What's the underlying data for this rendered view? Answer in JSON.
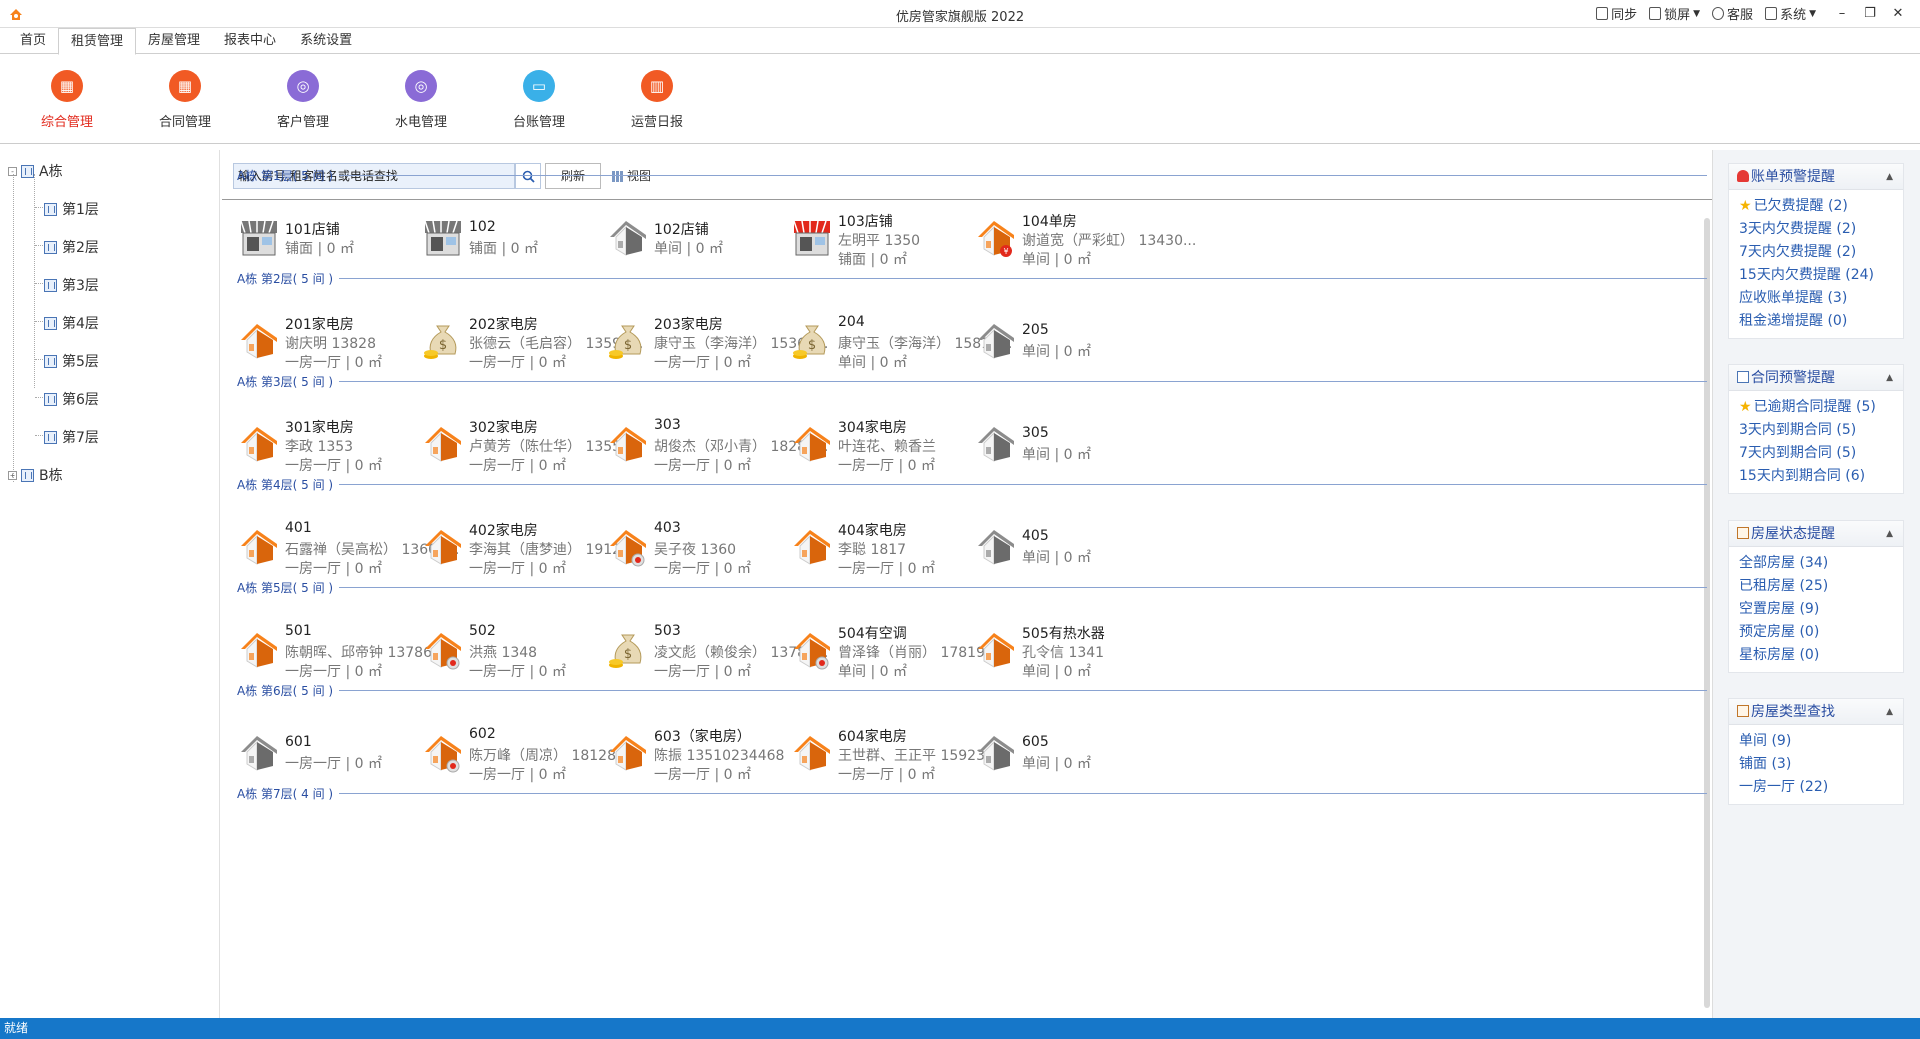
{
  "app": {
    "title": "优房管家旗舰版 2022"
  },
  "titlebar": {
    "sync": "同步",
    "lock": "锁屏",
    "service": "客服",
    "system": "系统",
    "minimize": "–",
    "restore": "❐",
    "close": "✕"
  },
  "tabs": [
    {
      "label": "首页"
    },
    {
      "label": "租赁管理"
    },
    {
      "label": "房屋管理"
    },
    {
      "label": "报表中心"
    },
    {
      "label": "系统设置"
    }
  ],
  "ribbon": [
    {
      "label": "综合管理",
      "color": "#f15a24",
      "icon": "grid-icon"
    },
    {
      "label": "合同管理",
      "color": "#f15a24",
      "icon": "grid-icon"
    },
    {
      "label": "客户管理",
      "color": "#8a6bd6",
      "icon": "target-icon"
    },
    {
      "label": "水电管理",
      "color": "#8a6bd6",
      "icon": "target-icon"
    },
    {
      "label": "台账管理",
      "color": "#3ab0e8",
      "icon": "ticket-icon"
    },
    {
      "label": "运营日报",
      "color": "#f15a24",
      "icon": "chart-icon"
    }
  ],
  "tree": {
    "building_a": "A栋",
    "floors": [
      "第1层",
      "第2层",
      "第3层",
      "第4层",
      "第5层",
      "第6层",
      "第7层"
    ],
    "building_b": "B栋"
  },
  "search": {
    "placeholder": "输入房号,租客姓名或电话查找",
    "refresh": "刷新",
    "view": "视图"
  },
  "floors": [
    {
      "title": "A栋 第1层( 5 间 )",
      "rooms": [
        {
          "name": "101店铺",
          "tenant": "",
          "type": "铺面 | 0 ㎡",
          "icon": "shop-gray"
        },
        {
          "name": "102",
          "tenant": "",
          "type": "铺面 | 0 ㎡",
          "icon": "shop-gray"
        },
        {
          "name": "102店铺",
          "tenant": "",
          "type": "单间 | 0 ㎡",
          "icon": "house-gray"
        },
        {
          "name": "103店铺",
          "tenant": "左明平 1350",
          "type": "铺面 | 0 ㎡",
          "icon": "shop-red"
        },
        {
          "name": "104单房",
          "tenant": "谢道宽（严彩虹） 13430...",
          "type": "单间 | 0 ㎡",
          "icon": "house-orange-money"
        }
      ]
    },
    {
      "title": "A栋 第2层( 5 间 )",
      "rooms": [
        {
          "name": "201家电房",
          "tenant": "谢庆明 13828",
          "type": "一房一厅 | 0 ㎡",
          "icon": "house-orange"
        },
        {
          "name": "202家电房",
          "tenant": "张德云（毛启容） 13590...",
          "type": "一房一厅 | 0 ㎡",
          "icon": "moneybag"
        },
        {
          "name": "203家电房",
          "tenant": "康守玉（李海洋） 15361...",
          "type": "一房一厅 | 0 ㎡",
          "icon": "moneybag"
        },
        {
          "name": "204",
          "tenant": "康守玉（李海洋） 15814...",
          "type": "单间 | 0 ㎡",
          "icon": "moneybag"
        },
        {
          "name": "205",
          "tenant": "",
          "type": "单间 | 0 ㎡",
          "icon": "house-gray"
        }
      ]
    },
    {
      "title": "A栋 第3层( 5 间 )",
      "rooms": [
        {
          "name": "301家电房",
          "tenant": "李政 1353",
          "type": "一房一厅 | 0 ㎡",
          "icon": "house-orange"
        },
        {
          "name": "302家电房",
          "tenant": "卢黄芳（陈仕华） 13554...",
          "type": "一房一厅 | 0 ㎡",
          "icon": "house-orange"
        },
        {
          "name": "303",
          "tenant": "胡俊杰（邓小青） 18284...",
          "type": "一房一厅 | 0 ㎡",
          "icon": "house-orange"
        },
        {
          "name": "304家电房",
          "tenant": "叶连花、赖香兰",
          "type": "一房一厅 | 0 ㎡",
          "icon": "house-orange"
        },
        {
          "name": "305",
          "tenant": "",
          "type": "单间 | 0 ㎡",
          "icon": "house-gray"
        }
      ]
    },
    {
      "title": "A栋 第4层( 5 间 )",
      "rooms": [
        {
          "name": "401",
          "tenant": "石露禅（吴高松） 13600...",
          "type": "一房一厅 | 0 ㎡",
          "icon": "house-orange"
        },
        {
          "name": "402家电房",
          "tenant": "李海其（唐梦迪） 19127...",
          "type": "一房一厅 | 0 ㎡",
          "icon": "house-orange"
        },
        {
          "name": "403",
          "tenant": "吴子夜 1360",
          "type": "一房一厅 | 0 ㎡",
          "icon": "house-orange-alert"
        },
        {
          "name": "404家电房",
          "tenant": "李聪 1817",
          "type": "一房一厅 | 0 ㎡",
          "icon": "house-orange"
        },
        {
          "name": "405",
          "tenant": "",
          "type": "单间 | 0 ㎡",
          "icon": "house-gray"
        }
      ]
    },
    {
      "title": "A栋 第5层( 5 间 )",
      "rooms": [
        {
          "name": "501",
          "tenant": "陈朝晖、邱帝钟 1378607...",
          "type": "一房一厅 | 0 ㎡",
          "icon": "house-orange"
        },
        {
          "name": "502",
          "tenant": "洪燕 1348",
          "type": "一房一厅 | 0 ㎡",
          "icon": "house-orange-alert"
        },
        {
          "name": "503",
          "tenant": "凌文彪（赖俊余） 13788...",
          "type": "一房一厅 | 0 ㎡",
          "icon": "moneybag"
        },
        {
          "name": "504有空调",
          "tenant": "曾泽锋（肖丽） 1781942...",
          "type": "单间 | 0 ㎡",
          "icon": "house-orange-alert"
        },
        {
          "name": "505有热水器",
          "tenant": "孔令信 1341",
          "type": "单间 | 0 ㎡",
          "icon": "house-orange"
        }
      ]
    },
    {
      "title": "A栋 第6层( 5 间 )",
      "rooms": [
        {
          "name": "601",
          "tenant": "",
          "type": "一房一厅 | 0 ㎡",
          "icon": "house-gray"
        },
        {
          "name": "602",
          "tenant": "陈万峰（周凉） 1812880...",
          "type": "一房一厅 | 0 ㎡",
          "icon": "house-orange-alert"
        },
        {
          "name": "603（家电房）",
          "tenant": "陈振 13510234468",
          "type": "一房一厅 | 0 ㎡",
          "icon": "house-orange"
        },
        {
          "name": "604家电房",
          "tenant": "王世群、王正平 1592380...",
          "type": "一房一厅 | 0 ㎡",
          "icon": "house-orange"
        },
        {
          "name": "605",
          "tenant": "",
          "type": "单间 | 0 ㎡",
          "icon": "house-gray"
        }
      ]
    },
    {
      "title": "A栋 第7层( 4 间 )",
      "rooms": []
    }
  ],
  "alerts": [
    {
      "title": "账单预警提醒",
      "icon": "bell-icon",
      "items": [
        "已欠费提醒 (2)",
        "3天内欠费提醒 (2)",
        "7天内欠费提醒 (2)",
        "15天内欠费提醒 (24)",
        "应收账单提醒 (3)",
        "租金递增提醒 (0)"
      ],
      "star_first": true
    },
    {
      "title": "合同预警提醒",
      "icon": "doc-icon",
      "items": [
        "已逾期合同提醒 (5)",
        "3天内到期合同 (5)",
        "7天内到期合同 (5)",
        "15天内到期合同 (6)"
      ],
      "star_first": true
    },
    {
      "title": "房屋状态提醒",
      "icon": "house-icon",
      "items": [
        "全部房屋 (34)",
        "已租房屋 (25)",
        "空置房屋 (9)",
        "预定房屋 (0)",
        "星标房屋 (0)"
      ],
      "star_first": false
    },
    {
      "title": "房屋类型查找",
      "icon": "house-icon",
      "items": [
        "单间 (9)",
        "铺面 (3)",
        "一房一厅 (22)"
      ],
      "star_first": false
    }
  ],
  "status": {
    "text": "就绪"
  },
  "colors": {
    "accent_red": "#e2291c",
    "link_blue": "#2a5db0",
    "status_blue": "#1677c9",
    "house_orange": "#f7821b",
    "house_gray": "#8c8c8c"
  }
}
